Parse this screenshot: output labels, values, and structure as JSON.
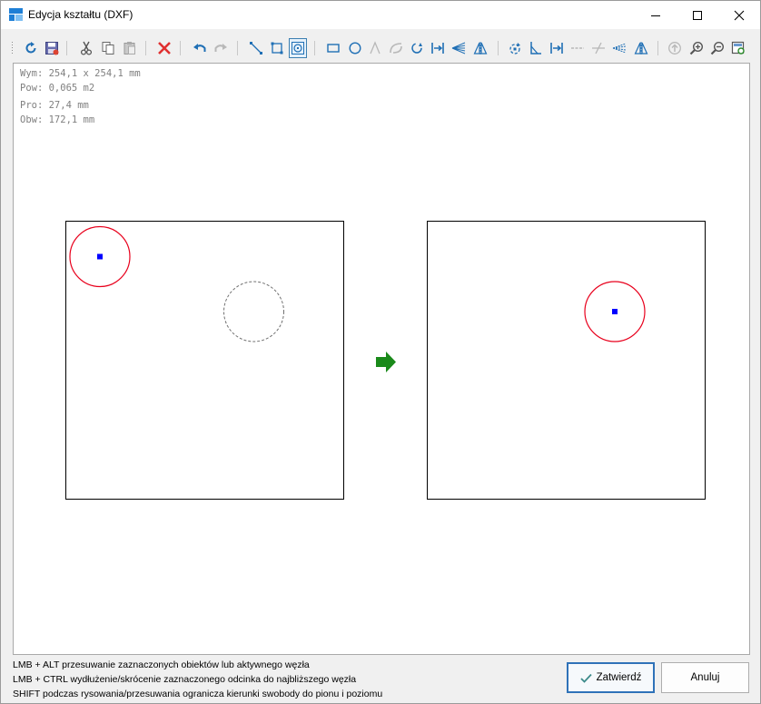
{
  "window": {
    "title": "Edycja kształtu (DXF)"
  },
  "toolbar": {
    "items": [
      {
        "icon": "refresh-icon",
        "tooltip": ""
      },
      {
        "icon": "save-icon"
      },
      {
        "icon": "cut-icon"
      },
      {
        "icon": "copy-icon"
      },
      {
        "icon": "paste-icon"
      },
      {
        "icon": "delete-icon"
      },
      {
        "icon": "undo-icon"
      },
      {
        "icon": "redo-icon"
      },
      {
        "icon": "line-select-icon"
      },
      {
        "icon": "rect-select-icon"
      },
      {
        "icon": "circle-select-icon",
        "active": true
      },
      {
        "icon": "rectangle-icon"
      },
      {
        "icon": "circle-icon"
      },
      {
        "icon": "fillet-icon"
      },
      {
        "icon": "arc-icon"
      },
      {
        "icon": "rotate-icon"
      },
      {
        "icon": "move-icon"
      },
      {
        "icon": "align-icon"
      },
      {
        "icon": "mirror-icon"
      },
      {
        "icon": "rotate-node-icon"
      },
      {
        "icon": "chamfer-icon"
      },
      {
        "icon": "move-node-icon"
      },
      {
        "icon": "split-icon"
      },
      {
        "icon": "trim-icon"
      },
      {
        "icon": "extend-icon"
      },
      {
        "icon": "mirror-node-icon"
      },
      {
        "icon": "up-icon"
      },
      {
        "icon": "zoom-in-icon"
      },
      {
        "icon": "zoom-out-icon"
      },
      {
        "icon": "zoom-fit-icon"
      }
    ]
  },
  "info": {
    "wym": "Wym: 254,1 x 254,1 mm",
    "pow": "Pow: 0,065 m2",
    "pro": "Pro: 27,4 mm",
    "obw": "Obw: 172,1 mm"
  },
  "colors": {
    "selection": "#e8001c",
    "node": "#0000ff",
    "arrow": "#1a8a1a",
    "accent": "#2f72b8"
  },
  "hints": {
    "line1": "LMB + ALT przesuwanie zaznaczonych obiektów lub aktywnego węzła",
    "line2": "LMB + CTRL wydłużenie/skrócenie zaznaczonego odcinka do najbliższego węzła",
    "line3": "SHIFT podczas rysowania/przesuwania ogranicza kierunki swobody do pionu i poziomu"
  },
  "buttons": {
    "ok": "Zatwierdź",
    "cancel": "Anuluj"
  }
}
